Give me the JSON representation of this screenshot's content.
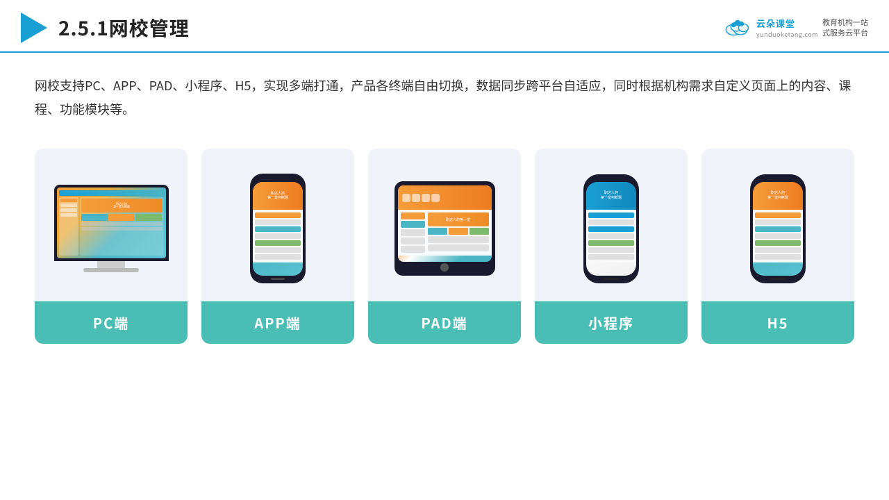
{
  "header": {
    "section_number": "2.5.1",
    "title": "网校管理",
    "brand": {
      "name": "云朵课堂",
      "url": "yunduoketang.com",
      "tagline": "教育机构一站\n式服务云平台"
    }
  },
  "description": "网校支持PC、APP、PAD、小程序、H5，实现多端打通，产品各终端自由切换，数据同步跨平台自适应，同时根据机构需求自定义页面上的内容、课程、功能模块等。",
  "cards": [
    {
      "id": "pc",
      "label": "PC端",
      "type": "pc"
    },
    {
      "id": "app",
      "label": "APP端",
      "type": "phone"
    },
    {
      "id": "pad",
      "label": "PAD端",
      "type": "tablet"
    },
    {
      "id": "miniprogram",
      "label": "小程序",
      "type": "phone-wechat"
    },
    {
      "id": "h5",
      "label": "H5",
      "type": "phone-h5"
    }
  ]
}
